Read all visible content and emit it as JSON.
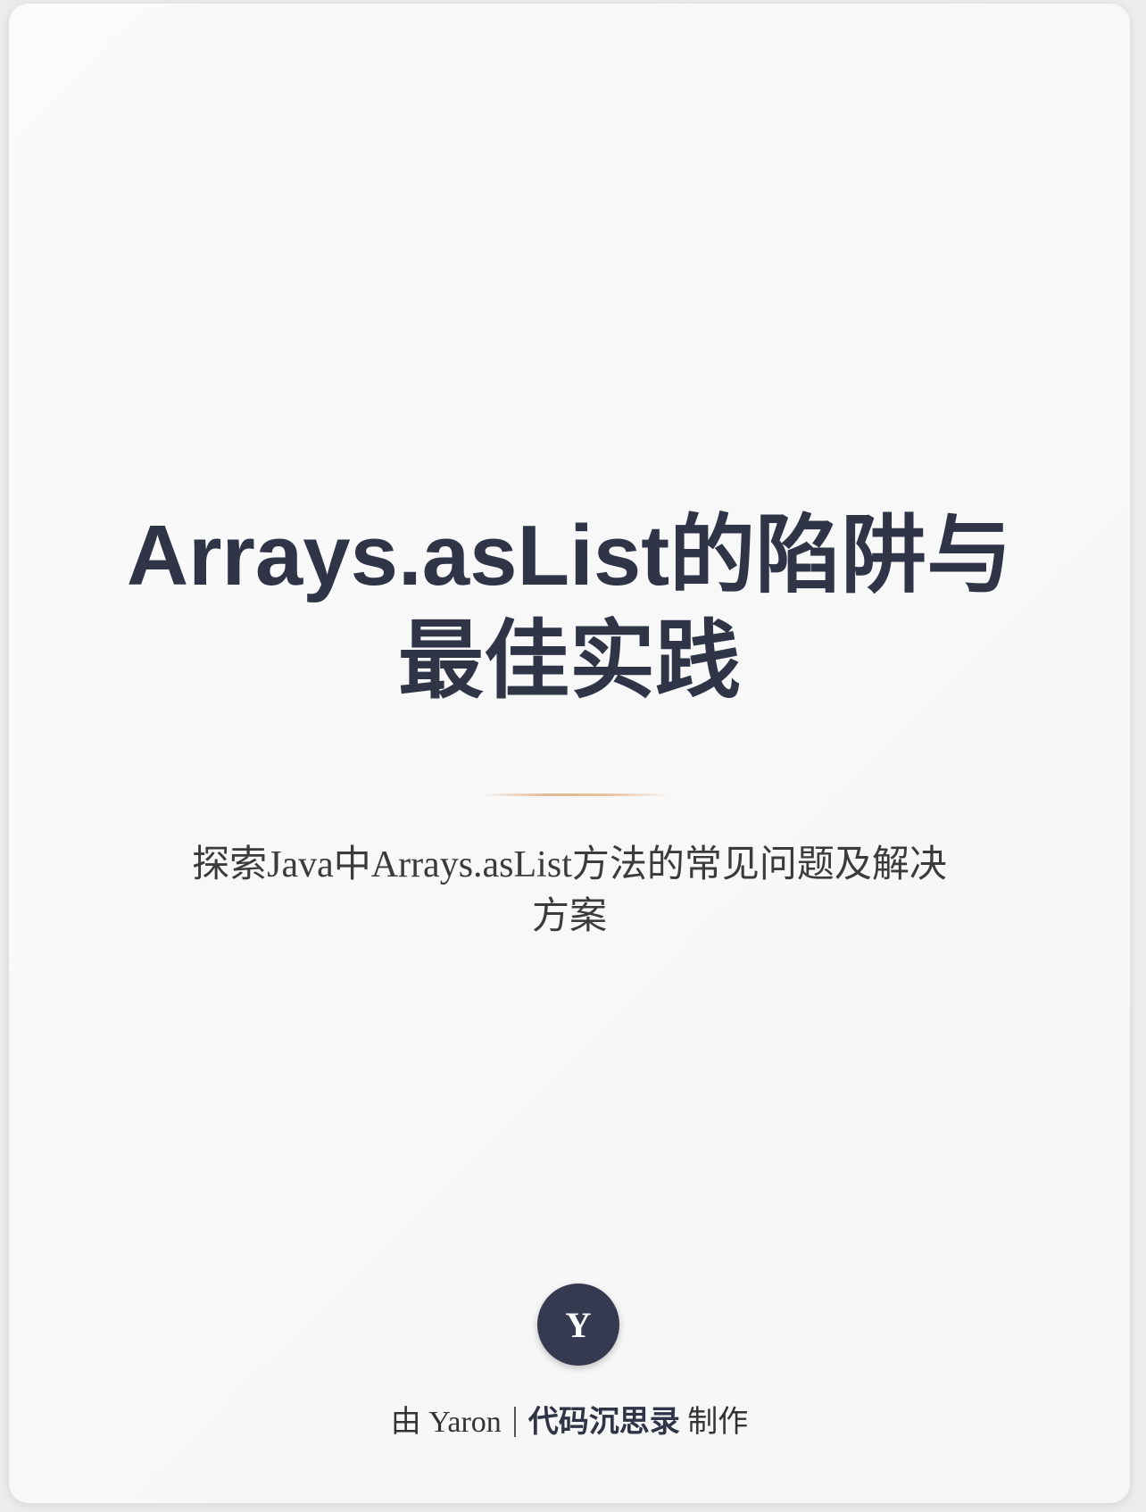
{
  "title": {
    "line1": "Arrays.asList的陷阱与",
    "line2": "最佳实践"
  },
  "subtitle": {
    "line1": "探索Java中Arrays.asList方法的常见问题及解决",
    "line2": "方案"
  },
  "avatar": {
    "initial": "Y"
  },
  "credit": {
    "prefix": "由 Yaron",
    "brand": "代码沉思录",
    "suffix": "制作"
  },
  "colors": {
    "title": "#2f3447",
    "avatar_bg": "#353a50",
    "divider": "#e2b894"
  }
}
